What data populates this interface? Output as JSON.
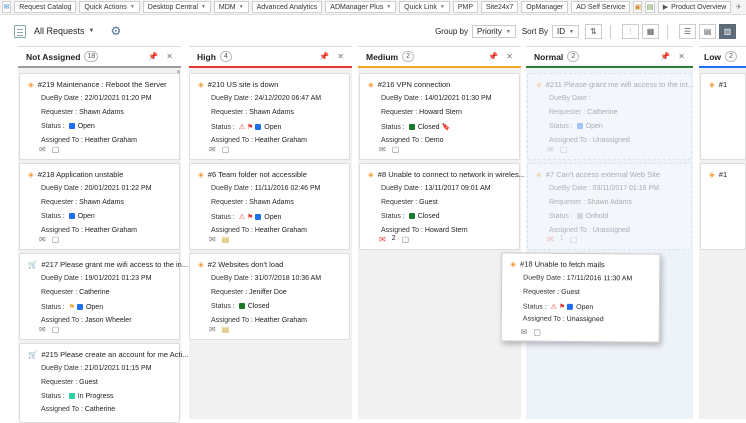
{
  "topbar": {
    "items": [
      "Request Catalog",
      "Quick Actions",
      "Desktop Central",
      "MDM",
      "Advanced Analytics",
      "ADManager Plus",
      "Quick Link",
      "PMP",
      "Site24x7",
      "OpManager",
      "AD Self Service"
    ],
    "product_overview": "Product Overview"
  },
  "toolbar": {
    "filter": "All Requests",
    "group_by_label": "Group by",
    "group_by_value": "Priority",
    "sort_by_label": "Sort By",
    "sort_by_value": "ID"
  },
  "columns": {
    "not_assigned": {
      "title": "Not Assigned",
      "count": "18"
    },
    "high": {
      "title": "High",
      "count": "4"
    },
    "medium": {
      "title": "Medium",
      "count": "2"
    },
    "normal": {
      "title": "Normal",
      "count": "2"
    },
    "low": {
      "title": "Low",
      "count": "2"
    }
  },
  "labels": {
    "due": "DueBy Date : ",
    "requester": "Requester : ",
    "status": "Status : ",
    "assigned": "Assigned To : "
  },
  "cards": {
    "c219": {
      "title": "#219 Maintenance : Reboot the Server",
      "due": "22/01/2021 01:20 PM",
      "requester": "Shawn Adams",
      "status": "Open",
      "assigned": "Heather Graham"
    },
    "c218": {
      "title": "#218 Application unstable",
      "due": "20/01/2021 01:22 PM",
      "requester": "Shawn Adams",
      "status": "Open",
      "assigned": "Heather Graham"
    },
    "c217": {
      "title": "#217 Please grant me wifi access to the in...",
      "due": "19/01/2021 01:23 PM",
      "requester": "Catherine",
      "status": "Open",
      "assigned": "Jason Wheeler"
    },
    "c215": {
      "title": "#215 Please create an account for me Acti...",
      "due": "21/01/2021 01:15 PM",
      "requester": "Guest",
      "status": "In Progress",
      "assigned": "Catherine"
    },
    "c210": {
      "title": "#210 US site is down",
      "due": "24/12/2020 06:47 AM",
      "requester": "Shawn Adams",
      "status": "Open",
      "assigned": "Heather Graham"
    },
    "c6": {
      "title": "#6 Team folder not accessible",
      "due": "11/11/2016 02:46 PM",
      "requester": "Shawn Adams",
      "status": "Open",
      "assigned": "Heather Graham"
    },
    "c2": {
      "title": "#2 Websites don't load",
      "due": "31/07/2018 10:36 AM",
      "requester": "Jeniffer Doe",
      "status": "Closed",
      "assigned": "Heather Graham"
    },
    "c216": {
      "title": "#216 VPN connection",
      "due": "14/01/2021 01:30 PM",
      "requester": "Howard Stern",
      "status": "Closed",
      "assigned": "Demo"
    },
    "c8": {
      "title": "#8 Unable to connect to network in wireles...",
      "due": "13/11/2017 09:01 AM",
      "requester": "Guest",
      "status": "Closed",
      "assigned": "Howard Stern",
      "mail_count": "2"
    },
    "c211": {
      "title": "#211 Please grant me wifi access to the int...",
      "due": "",
      "requester": "Catherine",
      "status": "Open",
      "assigned": "Unassigned"
    },
    "c7": {
      "title": "#7 Can't access external Web Site",
      "due": "03/11/2017 01:16 PM",
      "requester": "Shawn Adams",
      "status": "Onhold",
      "assigned": "Unassigned",
      "mail_count": "1"
    },
    "c18": {
      "title": "#18 Unable to fetch mails",
      "due": "17/11/2016 11:30 AM",
      "requester": "Guest",
      "status": "Open",
      "assigned": "Unassigned"
    },
    "low1": {
      "title": "#1"
    },
    "low2": {
      "title": "#1"
    }
  },
  "colors": {
    "open": "#1e6ff2",
    "closed": "#1b7a2a",
    "in_progress": "#2fd0a8",
    "onhold": "#9aa5b5",
    "accent": "#4b6f93"
  }
}
